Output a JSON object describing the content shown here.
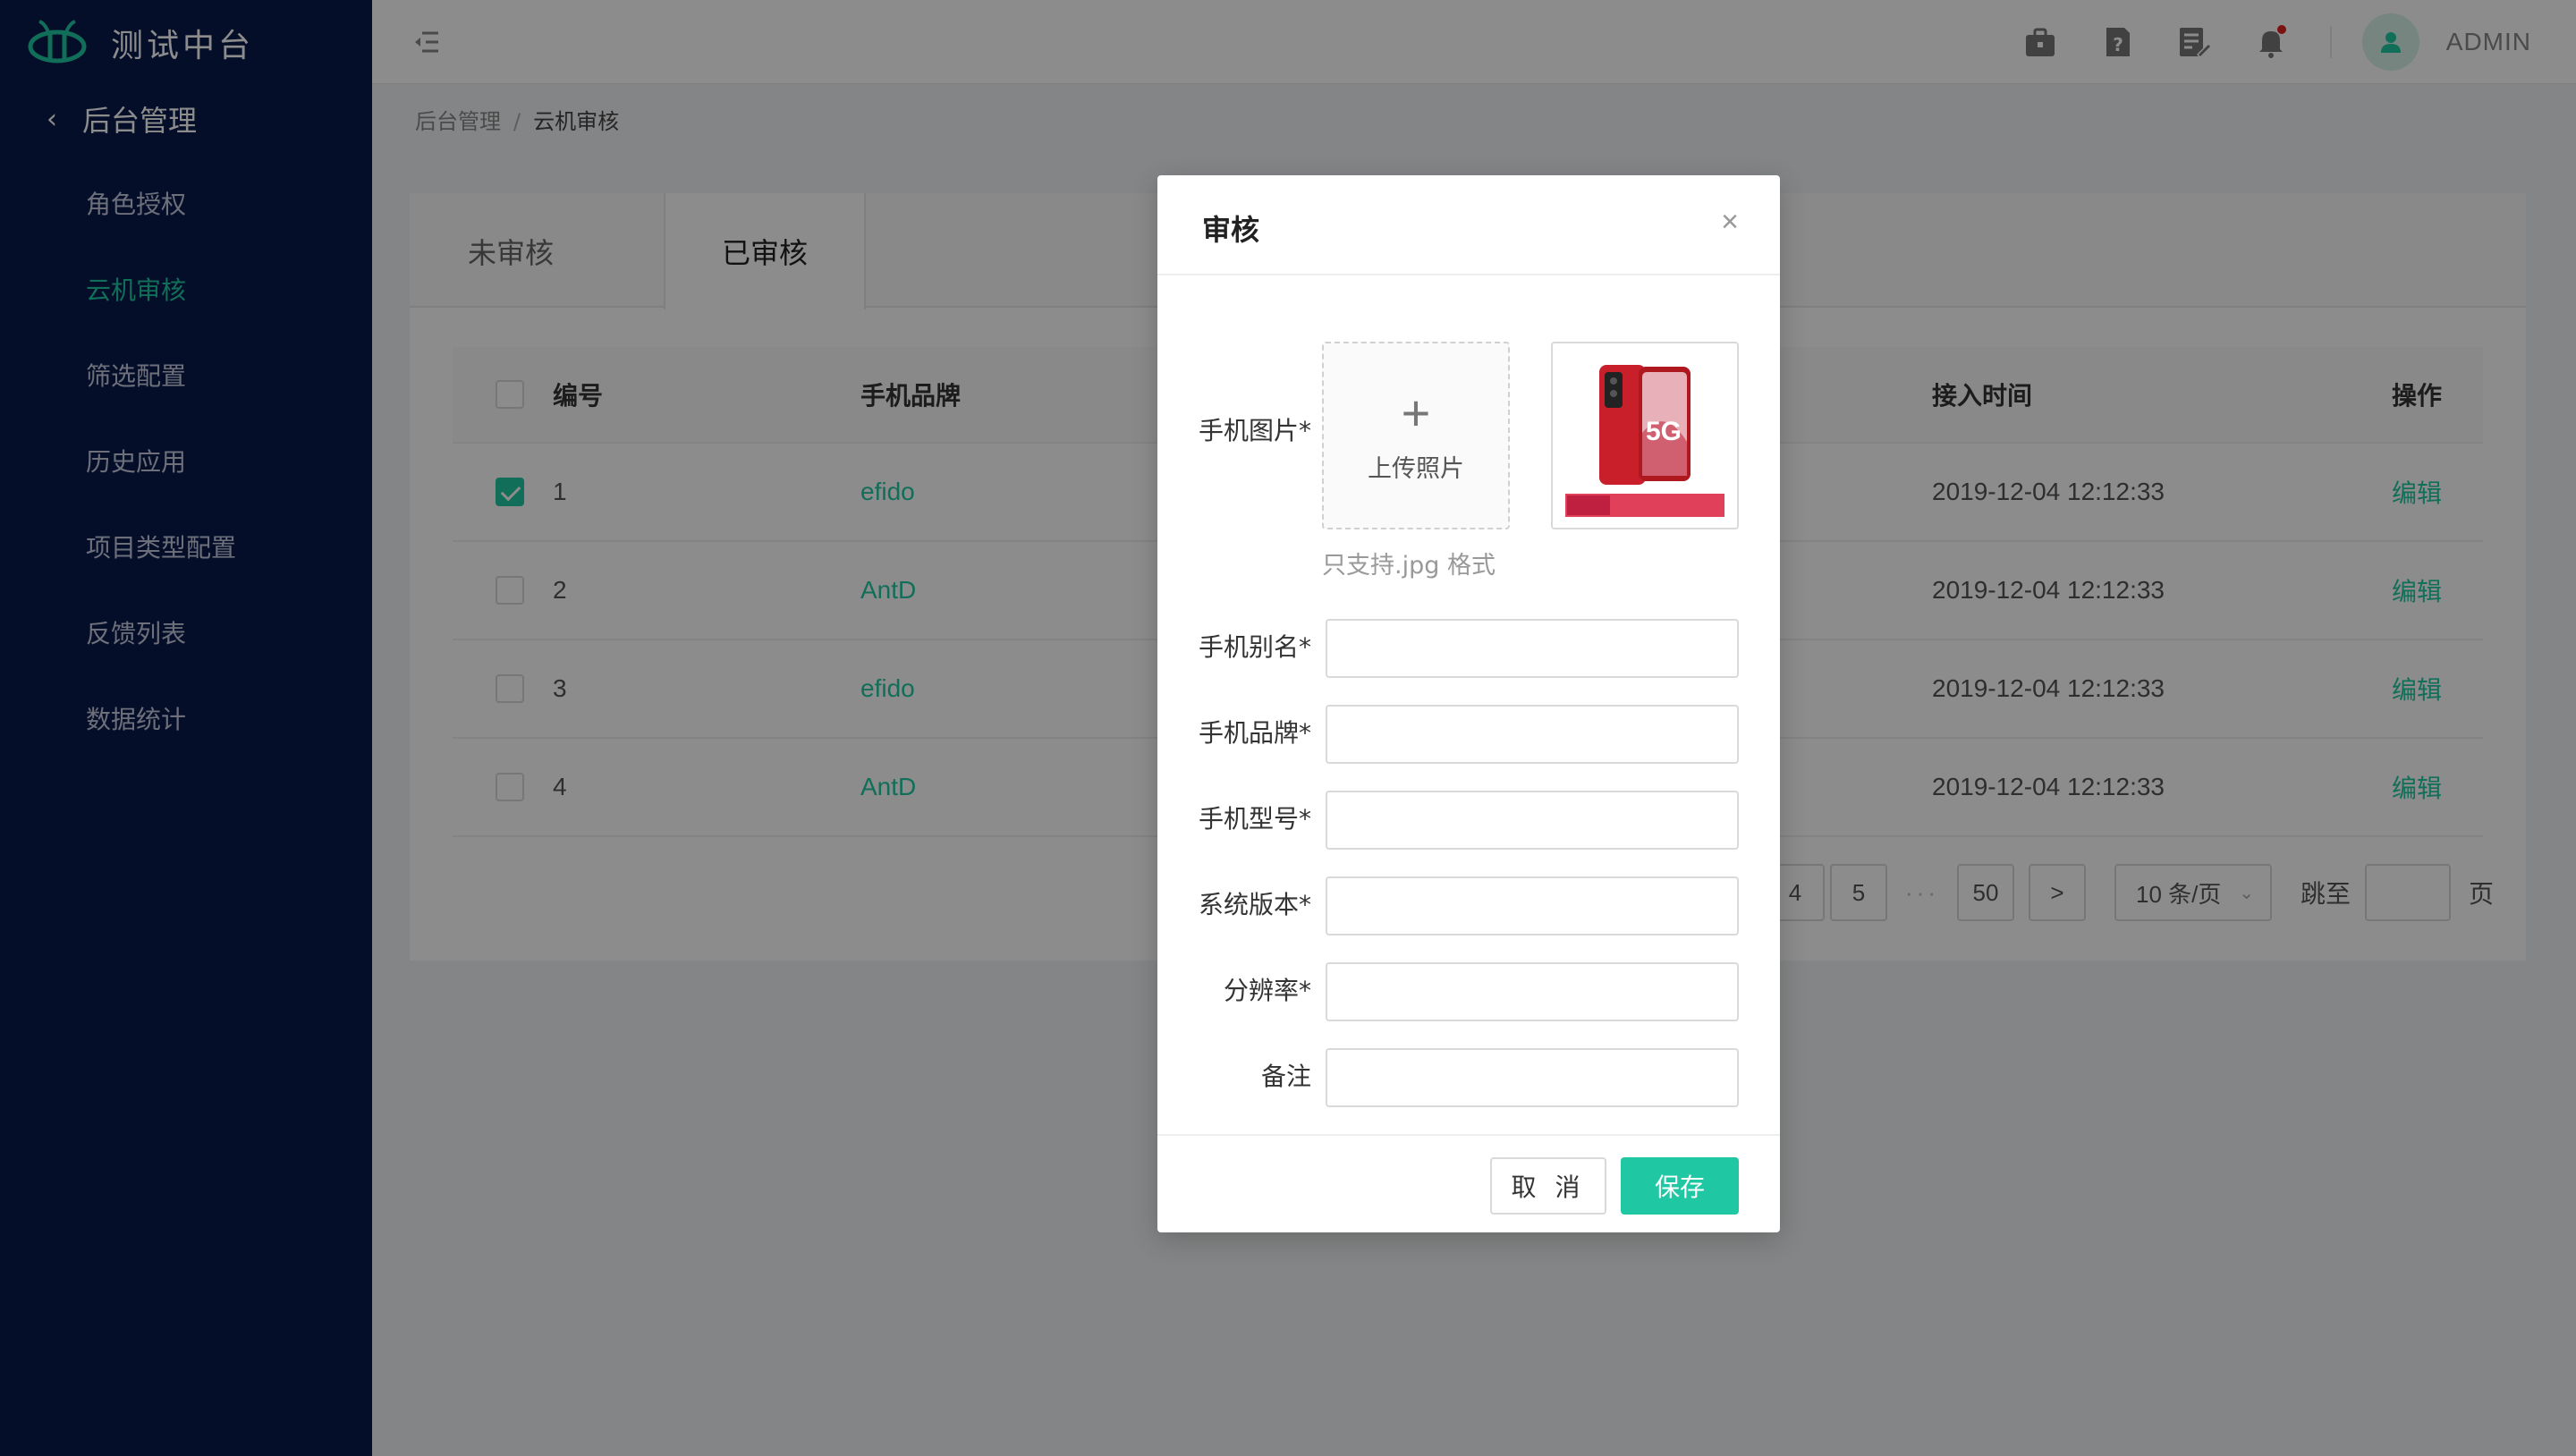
{
  "app": {
    "title": "测试中台"
  },
  "sidebar": {
    "section": "后台管理",
    "items": [
      {
        "label": "角色授权",
        "active": false
      },
      {
        "label": "云机审核",
        "active": true
      },
      {
        "label": "筛选配置",
        "active": false
      },
      {
        "label": "历史应用",
        "active": false
      },
      {
        "label": "项目类型配置",
        "active": false
      },
      {
        "label": "反馈列表",
        "active": false
      },
      {
        "label": "数据统计",
        "active": false
      }
    ]
  },
  "header": {
    "username": "ADMIN",
    "icons": [
      "briefcase-icon",
      "help-icon",
      "edit-note-icon",
      "bell-icon"
    ],
    "bell_has_dot": true
  },
  "breadcrumb": {
    "root": "后台管理",
    "sep": "/",
    "current": "云机审核"
  },
  "tabs": [
    {
      "label": "未审核",
      "active": false
    },
    {
      "label": "已审核",
      "active": true
    }
  ],
  "table": {
    "columns": {
      "id": "编号",
      "brand": "手机品牌",
      "time": "接入时间",
      "action": "操作"
    },
    "rows": [
      {
        "id": "1",
        "brand": "efido",
        "time": "2019-12-04 12:12:33",
        "action": "编辑",
        "checked": true
      },
      {
        "id": "2",
        "brand": "AntD",
        "time": "2019-12-04 12:12:33",
        "action": "编辑",
        "checked": false
      },
      {
        "id": "3",
        "brand": "efido",
        "time": "2019-12-04 12:12:33",
        "action": "编辑",
        "checked": false
      },
      {
        "id": "4",
        "brand": "AntD",
        "time": "2019-12-04 12:12:33",
        "action": "编辑",
        "checked": false
      }
    ]
  },
  "pagination": {
    "page_4": "4",
    "page_5": "5",
    "dots": "···",
    "last": "50",
    "next": ">",
    "page_size": "10 条/页",
    "jump_label": "跳至",
    "jump_suffix": "页"
  },
  "modal": {
    "title": "审核",
    "close": "×",
    "photo_label": "手机图片*",
    "upload_text": "上传照片",
    "upload_plus": "+",
    "upload_hint": "只支持.jpg 格式",
    "thumb_text": "5G",
    "fields": [
      {
        "label": "手机别名*",
        "value": ""
      },
      {
        "label": "手机品牌*",
        "value": ""
      },
      {
        "label": "手机型号*",
        "value": ""
      },
      {
        "label": "系统版本*",
        "value": ""
      },
      {
        "label": "分辨率*",
        "value": ""
      },
      {
        "label": "备注",
        "value": ""
      }
    ],
    "cancel": "取 消",
    "save": "保存"
  },
  "colors": {
    "accent": "#1fc8a3",
    "sidebar_bg": "#0a1a4a",
    "alert_dot": "#e02020"
  }
}
